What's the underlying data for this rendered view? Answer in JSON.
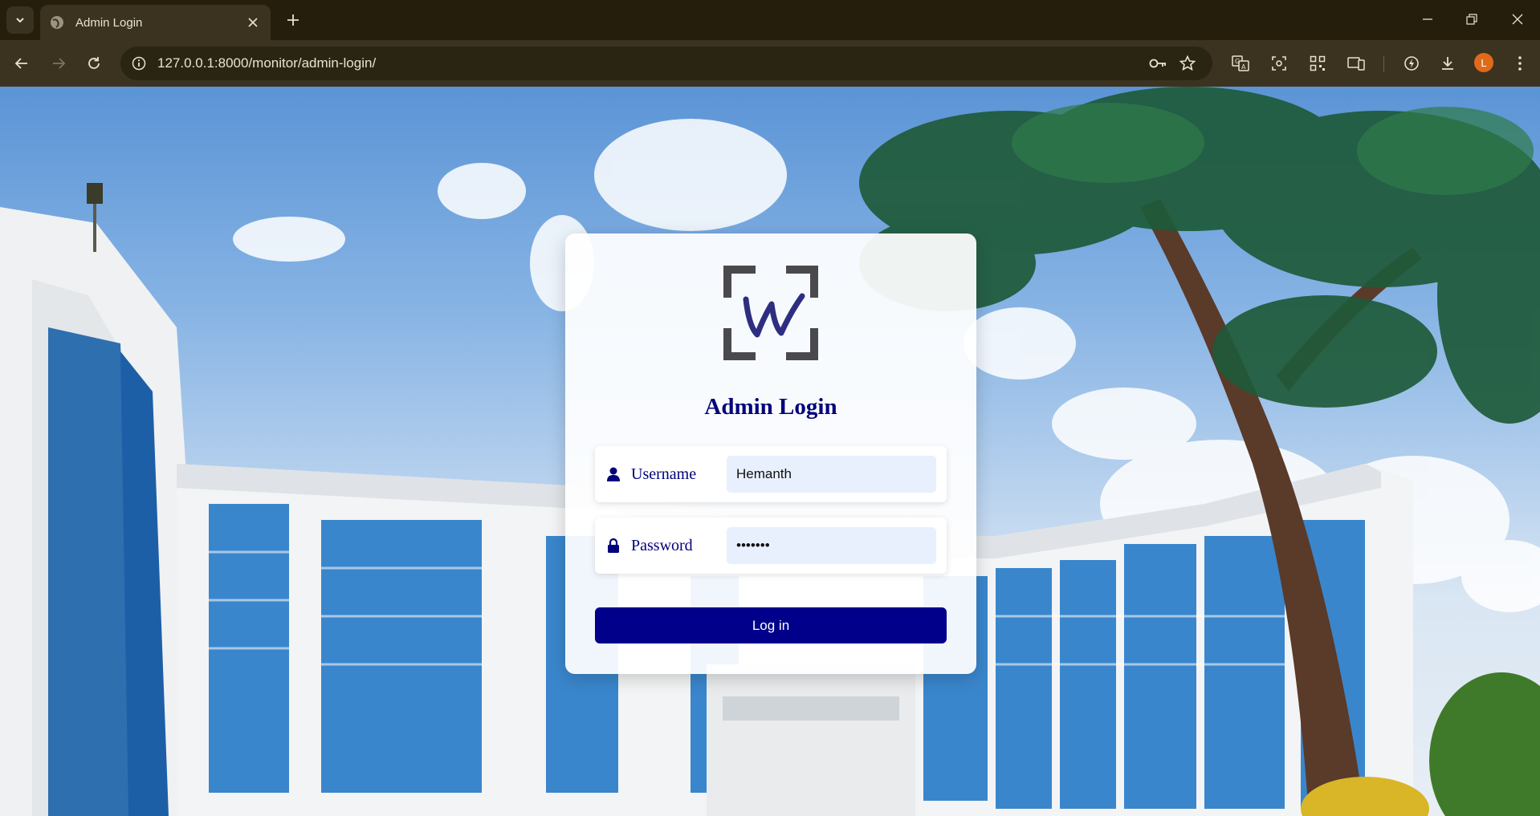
{
  "browser": {
    "tab_title": "Admin Login",
    "url": "127.0.0.1:8000/monitor/admin-login/",
    "profile_initial": "L",
    "profile_color": "#e06a1a"
  },
  "login": {
    "heading": "Admin Login",
    "username_label": "Username",
    "username_value": "Hemanth",
    "password_label": "Password",
    "password_value": "•••••••",
    "submit_label": "Log in",
    "accent_color": "#00008b"
  }
}
